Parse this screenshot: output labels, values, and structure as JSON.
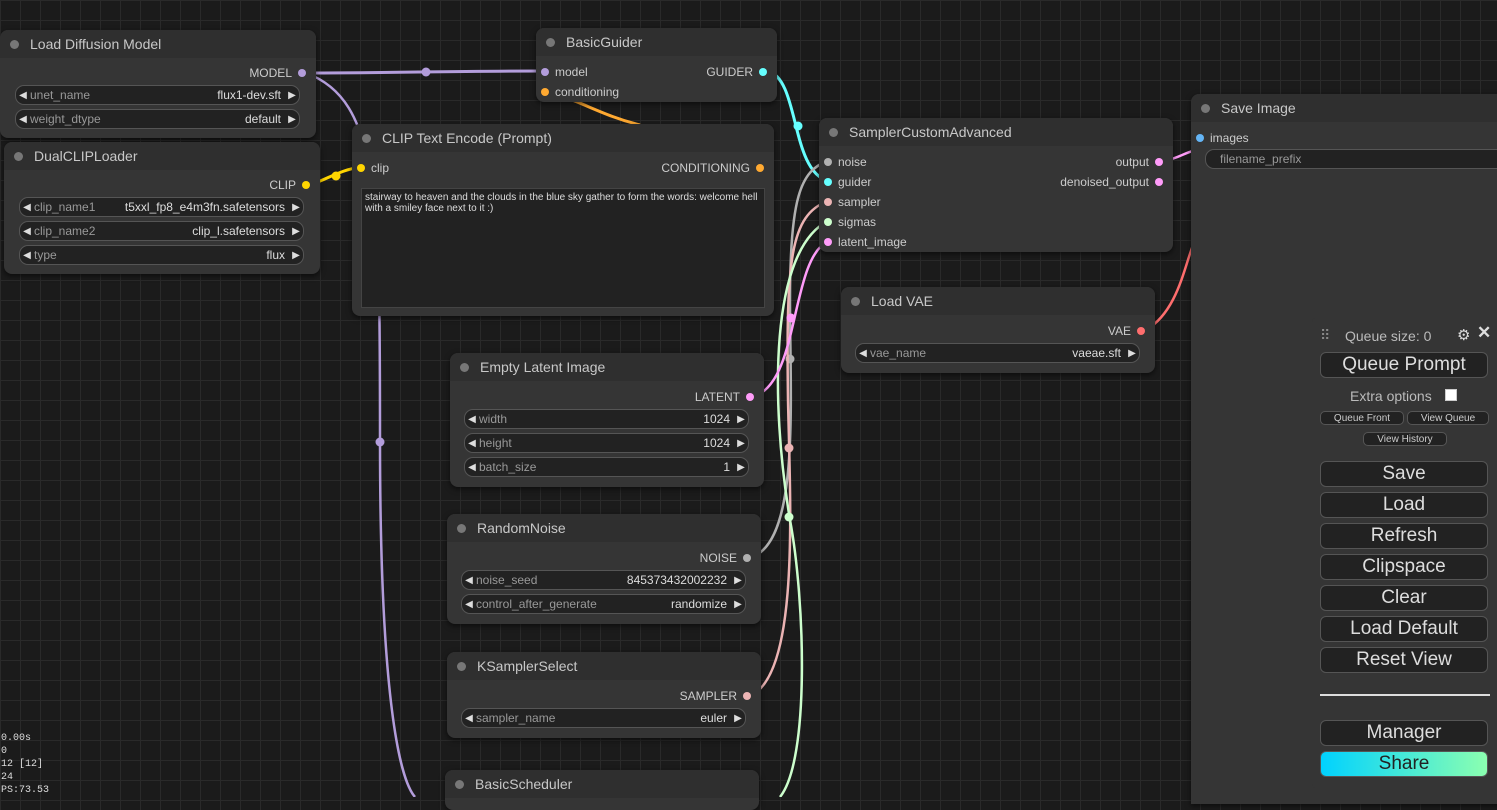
{
  "nodes": {
    "load_diffusion": {
      "title": "Load Diffusion Model",
      "output": "MODEL",
      "unet_name": {
        "label": "unet_name",
        "value": "flux1-dev.sft"
      },
      "weight_dtype": {
        "label": "weight_dtype",
        "value": "default"
      }
    },
    "dual_clip": {
      "title": "DualCLIPLoader",
      "output": "CLIP",
      "clip_name1": {
        "label": "clip_name1",
        "value": "t5xxl_fp8_e4m3fn.safetensors"
      },
      "clip_name2": {
        "label": "clip_name2",
        "value": "clip_l.safetensors"
      },
      "type": {
        "label": "type",
        "value": "flux"
      }
    },
    "basic_guider": {
      "title": "BasicGuider",
      "inputs": [
        "model",
        "conditioning"
      ],
      "output": "GUIDER"
    },
    "clip_text": {
      "title": "CLIP Text Encode (Prompt)",
      "input": "clip",
      "output": "CONDITIONING",
      "text": "stairway to heaven and the clouds in the blue sky gather to form the words: welcome hell with a smiley face next to it :)"
    },
    "sampler_custom": {
      "title": "SamplerCustomAdvanced",
      "inputs": [
        "noise",
        "guider",
        "sampler",
        "sigmas",
        "latent_image"
      ],
      "outputs": [
        "output",
        "denoised_output"
      ]
    },
    "save_image": {
      "title": "Save Image",
      "input": "images",
      "filename_prefix": "filename_prefix"
    },
    "load_vae": {
      "title": "Load VAE",
      "output": "VAE",
      "vae_name": {
        "label": "vae_name",
        "value": "vaeae.sft"
      }
    },
    "empty_latent": {
      "title": "Empty Latent Image",
      "output": "LATENT",
      "width": {
        "label": "width",
        "value": "1024"
      },
      "height": {
        "label": "height",
        "value": "1024"
      },
      "batch_size": {
        "label": "batch_size",
        "value": "1"
      }
    },
    "random_noise": {
      "title": "RandomNoise",
      "output": "NOISE",
      "noise_seed": {
        "label": "noise_seed",
        "value": "845373432002232"
      },
      "control_after_generate": {
        "label": "control_after_generate",
        "value": "randomize"
      }
    },
    "ksampler_select": {
      "title": "KSamplerSelect",
      "output": "SAMPLER",
      "sampler_name": {
        "label": "sampler_name",
        "value": "euler"
      }
    },
    "basic_scheduler": {
      "title": "BasicScheduler"
    }
  },
  "queue_panel": {
    "queue_size": "Queue size: 0",
    "queue_prompt": "Queue Prompt",
    "extra_options": "Extra options",
    "queue_front": "Queue Front",
    "view_queue": "View Queue",
    "view_history": "View History",
    "save": "Save",
    "load": "Load",
    "refresh": "Refresh",
    "clipspace": "Clipspace",
    "clear": "Clear",
    "load_default": "Load Default",
    "reset_view": "Reset View",
    "manager": "Manager",
    "share": "Share"
  },
  "stats": [
    "0.00s",
    "0",
    "12 [12]",
    "24",
    "PS:73.53"
  ],
  "colors": {
    "model": "#b39ddb",
    "clip": "#ffd500",
    "conditioning": "#ffa931",
    "guider": "#66ffff",
    "noise": "#b0b0b0",
    "sampler": "#ecb4b4",
    "sigmas": "#cdffcd",
    "latent": "#ff9cf9",
    "vae": "#ff6e6e",
    "image": "#64b5f6"
  }
}
